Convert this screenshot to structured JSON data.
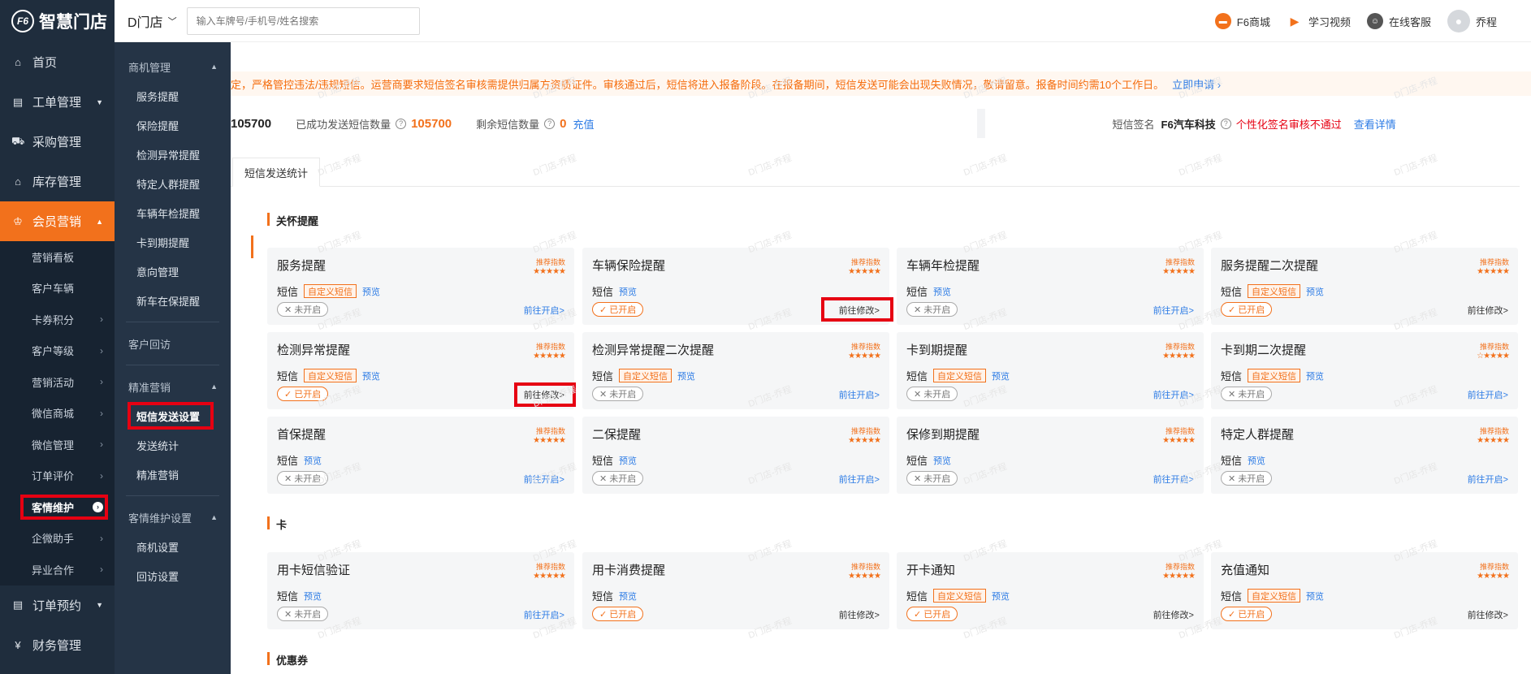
{
  "app": {
    "logo_text": "智慧门店",
    "logo_mark": "F6"
  },
  "topbar": {
    "store_name": "D门店",
    "search_placeholder": "输入车牌号/手机号/姓名搜索",
    "links": [
      {
        "label": "F6商城",
        "icon": "shop-icon",
        "color": "#f2711c"
      },
      {
        "label": "学习视频",
        "icon": "play-icon",
        "color": "#f2711c"
      },
      {
        "label": "在线客服",
        "icon": "agent-avatar-icon"
      },
      {
        "label": "乔程",
        "icon": "user-avatar-icon"
      }
    ]
  },
  "sidebar": {
    "items": [
      {
        "label": "首页",
        "icon": "home-icon"
      },
      {
        "label": "工单管理",
        "icon": "workorder-icon"
      },
      {
        "label": "采购管理",
        "icon": "cart-icon"
      },
      {
        "label": "库存管理",
        "icon": "warehouse-icon"
      },
      {
        "label": "会员营销",
        "icon": "crown-icon"
      },
      {
        "label": "订单预约",
        "icon": "order-icon"
      },
      {
        "label": "财务管理",
        "icon": "yen-icon"
      }
    ],
    "subitems": [
      "营销看板",
      "客户车辆",
      "卡券积分",
      "客户等级",
      "营销活动",
      "微信商城",
      "微信管理",
      "订单评价",
      "客情维护",
      "企微助手",
      "异业合作"
    ]
  },
  "submenu": {
    "group1": "商机管理",
    "group1_items": [
      "服务提醒",
      "保险提醒",
      "检测异常提醒",
      "特定人群提醒",
      "车辆年检提醒",
      "卡到期提醒",
      "意向管理",
      "新车在保提醒"
    ],
    "single": "客户回访",
    "group2": "精准营销",
    "group2_items": [
      "短信发送设置",
      "发送统计",
      "精准营销"
    ],
    "group3": "客情维护设置",
    "group3_items": [
      "商机设置",
      "回访设置"
    ]
  },
  "notice": {
    "text": "定，严格管控违法/违规短信。运营商要求短信签名审核需提供归属方资质证件。审核通过后，短信将进入报备阶段。在报备期间，短信发送可能会出现失败情况，敬请留意。报备时间约需10个工作日。",
    "link": "立即申请"
  },
  "stats": {
    "total_value": "105700",
    "sent_label": "已成功发送短信数量",
    "sent_value": "105700",
    "remain_label": "剩余短信数量",
    "remain_value": "0",
    "recharge": "充值",
    "sign_label": "短信签名",
    "sign_value": "F6汽车科技",
    "sign_status": "个性化签名审核不通过",
    "detail_link": "查看详情"
  },
  "tab": "短信发送统计",
  "card_labels": {
    "recommend": "推荐指数",
    "sms": "短信",
    "custom": "自定义短信",
    "preview": "预览",
    "off": "未开启",
    "on": "已开启",
    "go_open": "前往开启>",
    "go_edit": "前往修改>"
  },
  "sections": [
    {
      "title": "关怀提醒",
      "cards": [
        {
          "title": "服务提醒",
          "custom": true,
          "on": false,
          "stars": "★★★★★"
        },
        {
          "title": "车辆保险提醒",
          "custom": false,
          "on": true,
          "stars": "★★★★★"
        },
        {
          "title": "车辆年检提醒",
          "custom": false,
          "on": false,
          "stars": "★★★★★"
        },
        {
          "title": "服务提醒二次提醒",
          "custom": true,
          "on": true,
          "stars": "★★★★★"
        },
        {
          "title": "检测异常提醒",
          "custom": true,
          "on": true,
          "stars": "★★★★★"
        },
        {
          "title": "检测异常提醒二次提醒",
          "custom": true,
          "on": false,
          "stars": "★★★★★"
        },
        {
          "title": "卡到期提醒",
          "custom": true,
          "on": false,
          "stars": "★★★★★"
        },
        {
          "title": "卡到期二次提醒",
          "custom": true,
          "on": false,
          "stars": "☆★★★★"
        },
        {
          "title": "首保提醒",
          "custom": false,
          "on": false,
          "stars": "★★★★★"
        },
        {
          "title": "二保提醒",
          "custom": false,
          "on": false,
          "stars": "★★★★★"
        },
        {
          "title": "保修到期提醒",
          "custom": false,
          "on": false,
          "stars": "★★★★★"
        },
        {
          "title": "特定人群提醒",
          "custom": false,
          "on": false,
          "stars": "★★★★★"
        }
      ]
    },
    {
      "title": "卡",
      "cards": [
        {
          "title": "用卡短信验证",
          "custom": false,
          "on": false,
          "stars": "★★★★★"
        },
        {
          "title": "用卡消费提醒",
          "custom": false,
          "on": true,
          "stars": "★★★★★"
        },
        {
          "title": "开卡通知",
          "custom": true,
          "on": true,
          "stars": "★★★★★"
        },
        {
          "title": "充值通知",
          "custom": true,
          "on": true,
          "stars": "★★★★★"
        }
      ]
    },
    {
      "title": "优惠券",
      "cards": []
    }
  ],
  "watermark": "D门店-乔程",
  "colors": {
    "accent": "#f2711c",
    "sidebar": "#1f2d3d",
    "link": "#2c7be5",
    "highlight": "#e60012"
  }
}
